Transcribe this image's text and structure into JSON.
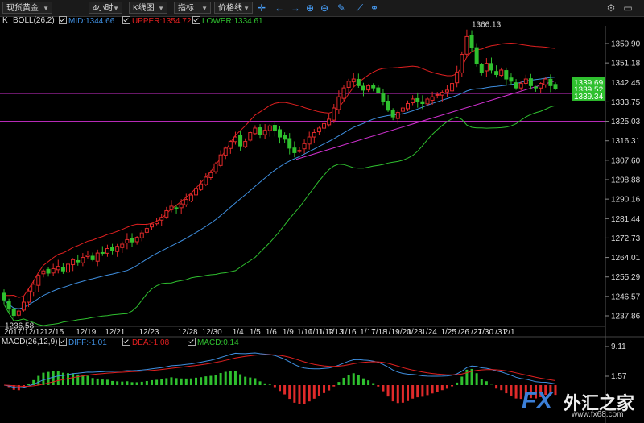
{
  "toolbar": {
    "instrument": "现货黄金",
    "period": "4小时",
    "chart_type": "K线图",
    "indicator": "指标",
    "price_line": "价格线",
    "icons": [
      "crosshair-icon",
      "arrow-left-icon",
      "arrow-right-icon",
      "zoom-in-icon",
      "zoom-out-icon",
      "draw-pen-icon",
      "link-icon"
    ]
  },
  "legend": {
    "k": "K",
    "boll": "BOLL(26,2)",
    "mid": "MID:1344.66",
    "upper": "UPPER:1354.72",
    "lower": "LOWER:1334.61",
    "colors": {
      "mid": "#3f8fe0",
      "upper": "#e02020",
      "lower": "#2fc02f"
    }
  },
  "macd_legend": {
    "name": "MACD(26,12,9)",
    "diff": "DIFF:-1.01",
    "dea": "DEA:-1.08",
    "macd": "MACD:0.14",
    "colors": {
      "diff": "#3f8fe0",
      "dea": "#e02020",
      "macd": "#2fc02f"
    }
  },
  "price_tags": [
    {
      "text": "1339.69",
      "color": "#2fc02f"
    },
    {
      "text": "1339.52",
      "color": "#2fc02f"
    },
    {
      "text": "1339.34",
      "color": "#2fc02f"
    }
  ],
  "annotations": {
    "high": "1366.13",
    "low": "1236.58",
    "partial_tick": "1342.45"
  },
  "chart_data": [
    {
      "type": "candlestick",
      "ylim": [
        1230,
        1370
      ],
      "yticks": [
        1359.9,
        1351.18,
        1333.75,
        1325.03,
        1316.31,
        1307.6,
        1298.88,
        1290.16,
        1281.44,
        1272.73,
        1264.01,
        1255.29,
        1246.57,
        1237.86
      ],
      "xticks": [
        "2017/12/12",
        "12/15",
        "12/19",
        "12/21",
        "12/23",
        "12/28",
        "12/30",
        "1/4",
        "1/5",
        "1/6",
        "1/9",
        "1/10",
        "1/11",
        "1/12",
        "1/13",
        "1/16",
        "1/17",
        "1/18",
        "1/19",
        "1/20",
        "1/23",
        "1/24",
        "1/25",
        "1/26",
        "1/27",
        "1/30",
        "1/31",
        "2/1"
      ],
      "close": [
        1245,
        1241,
        1238,
        1240,
        1244,
        1249,
        1252,
        1256,
        1258,
        1257,
        1259,
        1260,
        1258,
        1261,
        1263,
        1262,
        1264,
        1265,
        1263,
        1266,
        1266,
        1268,
        1267,
        1269,
        1270,
        1272,
        1271,
        1273,
        1275,
        1277,
        1279,
        1280,
        1282,
        1285,
        1287,
        1286,
        1288,
        1290,
        1292,
        1295,
        1297,
        1300,
        1302,
        1306,
        1310,
        1313,
        1316,
        1318,
        1314,
        1316,
        1320,
        1322,
        1319,
        1321,
        1323,
        1321,
        1318,
        1317,
        1313,
        1311,
        1312,
        1315,
        1318,
        1320,
        1322,
        1324,
        1326,
        1331,
        1336,
        1340,
        1343,
        1344,
        1341,
        1339,
        1341,
        1340,
        1338,
        1334,
        1330,
        1327,
        1329,
        1331,
        1333,
        1335,
        1334,
        1333,
        1335,
        1336,
        1337,
        1338,
        1339,
        1342,
        1347,
        1355,
        1363,
        1358,
        1351,
        1347,
        1351,
        1348,
        1346,
        1348,
        1344,
        1343,
        1340,
        1342,
        1344,
        1341,
        1340,
        1342,
        1344,
        1341,
        1339.5
      ],
      "series": [
        {
          "name": "MID",
          "color": "#3f8fe0"
        },
        {
          "name": "UPPER",
          "color": "#e02020"
        },
        {
          "name": "LOWER",
          "color": "#2fc02f"
        }
      ],
      "horizontal_lines": [
        {
          "value": 1339.52,
          "color": "#3f8fe0",
          "style": "dotted"
        },
        {
          "value": 1337.5,
          "color": "#d030d0",
          "style": "solid"
        },
        {
          "value": 1325.03,
          "color": "#d030d0",
          "style": "solid"
        }
      ],
      "high": 1366.13,
      "low": 1236.58
    },
    {
      "type": "bar",
      "name": "MACD(26,12,9)",
      "yticks": [
        9.11,
        1.57
      ],
      "series": [
        {
          "name": "DIFF",
          "color": "#3f8fe0"
        },
        {
          "name": "DEA",
          "color": "#e02020"
        },
        {
          "name": "MACD",
          "color": "#2fc02f"
        }
      ]
    }
  ],
  "watermark": {
    "fx": "FX",
    "cn": "外汇之家",
    "url": "www.fx68.com"
  }
}
